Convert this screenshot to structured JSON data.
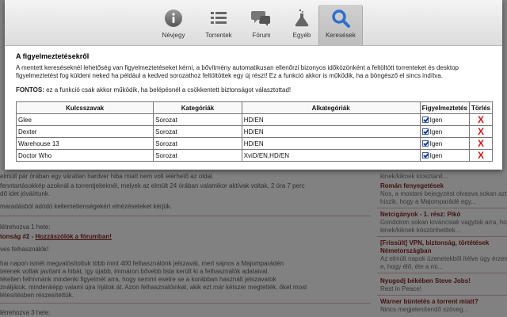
{
  "toolbar": {
    "items": [
      {
        "label": "Névjegy",
        "icon": "info-icon"
      },
      {
        "label": "Torrentek",
        "icon": "list-icon"
      },
      {
        "label": "Fórum",
        "icon": "chat-bubbles-icon"
      },
      {
        "label": "Egyéb",
        "icon": "flask-icon"
      },
      {
        "label": "Keresések",
        "icon": "search-icon",
        "active": true
      }
    ]
  },
  "panel": {
    "heading": "A figyelmeztetésekről",
    "description": "A mentett kereséseknél lehetőség van figyelmeztetéseket kérni, a bővítmény automatikusan ellenőrzi bizonyos időközönként a feltöltött torrenteket és desktop figyelmeztetést fog küldeni neked ha például a kedved sorozathoz feltöltöttek egy új részt! Ez a funkció akkor is működik, ha a böngésző el sincs indítva.",
    "note_bold": "FONTOS:",
    "note_text": " ez a funkció csak akkor működik, ha belépésnél a csökkentett biztonságot választottad!"
  },
  "table": {
    "headers": {
      "keywords": "Kulcsszavak",
      "categories": "Kategóriák",
      "subcategories": "Alkategóriák",
      "alert": "Figyelmeztetés",
      "delete": "Törlés"
    },
    "rows": [
      {
        "keyword": "Glee",
        "category": "Sorozat",
        "subcategory": "HD/EN",
        "alert": "Igen",
        "alert_checked": true
      },
      {
        "keyword": "Dexter",
        "category": "Sorozat",
        "subcategory": "HD/EN",
        "alert": "Igen",
        "alert_checked": true
      },
      {
        "keyword": "Warehouse 13",
        "category": "Sorozat",
        "subcategory": "HD/EN",
        "alert": "Igen",
        "alert_checked": true
      },
      {
        "keyword": "Doctor Who",
        "category": "Sorozat",
        "subcategory": "XviD/EN,HD/EN",
        "alert": "Igen",
        "alert_checked": true
      }
    ],
    "delete_glyph": "X"
  },
  "background": {
    "left": {
      "l1": "elmúlt pár órában egy váratlan hardver hiba miatt nem volt elérhető az oldal.",
      "l2": "fenntartásokkép azoknál a torrentjeiteknél, melyek az elmúlt 24 órában valamikor aktívak voltak, 2 óra 7 perc",
      "l3": "dő idet jóváírtunk.",
      "l4": "maradásból adódó kellemetlenségekért elnézéseteket kérjük.",
      "l5": "létrehozva 1 hete:",
      "l6_prefix": "tonság #2 - ",
      "l6_link": "Hozzászólók a fórumban!",
      "l7": "ves felhasználók!",
      "l8": "hai napon ismét megvalósítottuk több mint 400 felhasználónk jelszavát, mert sajnos a Majomparádén",
      "l9": "telenek voltak javítani a hibát, így újabb, immáron bővebb lista került ki a felhasználók adataival.",
      "l10": "tételten felhívnánk mindenki figyelmét arra, hogy semmi esetre se a korábban használt jelszavatok",
      "l11": "ználjátok, mindenképp valami újra írjátok át. Azon felhasználóinkat, akik ezt már kétszer megtették, őket most",
      "l12": "létesítésben részesítettük.",
      "l13": "létrehozva 3 hete:"
    },
    "right": {
      "r1": "kinek/kiknek kiosztanil...",
      "r2": "Román fenyegetések",
      "r3": "Nos, a mostani bejegyzést olvasva sokan azt",
      "r4": "hiszik, hogy a Majomparádé egy...",
      "r5": "Netcigányok - 1. rész: Pikó",
      "r6": "Gondolom sokan kíváncsiak vagytok arra, hogy",
      "r7": "kinek/kiknek köszönhetitek...",
      "r8": "[Frissült] VPN, biztonság, törtétések",
      "r9": "Németországban",
      "r10": "Az elmúlt napok üzenetekből ítélve úgy érzem",
      "r11": "e, hogy élő, éte a mi...",
      "r12": "Nyugodj békében Steve Jobs!",
      "r13": "Rest in Peace!",
      "r14": "Warner büntetés a torrent miatt?",
      "r15": "Nincs megjelenítendő szöveg..."
    }
  },
  "colors": {
    "accent_blue": "#2d6fd1",
    "delete_red": "#d41515",
    "brand_red": "#7a1a1a"
  }
}
